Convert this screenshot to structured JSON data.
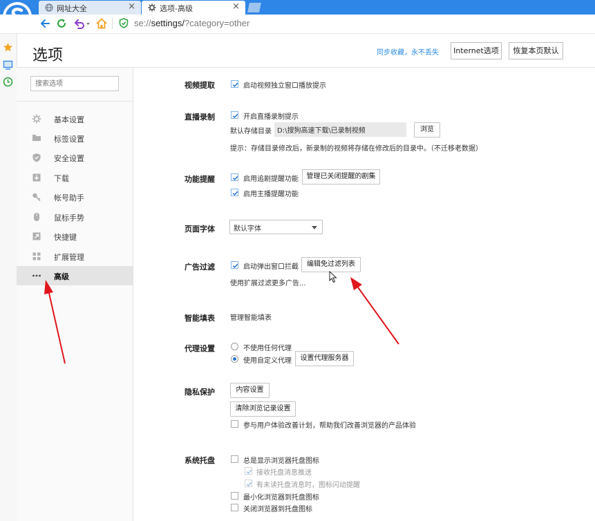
{
  "tabs": [
    {
      "title": "网址大全",
      "close": "×",
      "icon": "globe-icon",
      "active": false
    },
    {
      "title": "选项-高级",
      "close": "×",
      "icon": "gear-icon",
      "active": true
    }
  ],
  "address": {
    "scheme": "se://",
    "path": "settings/",
    "query": "?category=other"
  },
  "page": {
    "title": "选项",
    "sync_link": "同步收藏，永不丢失",
    "internet_options": "Internet选项",
    "restore_defaults": "恢复本页默认"
  },
  "search": {
    "placeholder": "搜索选项"
  },
  "sidebar": {
    "items": [
      {
        "label": "基本设置",
        "icon": "gear-icon",
        "active": false
      },
      {
        "label": "标签设置",
        "icon": "tab-icon",
        "active": false
      },
      {
        "label": "安全设置",
        "icon": "shield-icon",
        "active": false
      },
      {
        "label": "下载",
        "icon": "download-icon",
        "active": false
      },
      {
        "label": "帐号助手",
        "icon": "key-icon",
        "active": false
      },
      {
        "label": "鼠标手势",
        "icon": "mouse-icon",
        "active": false
      },
      {
        "label": "快捷键",
        "icon": "shortcut-icon",
        "active": false
      },
      {
        "label": "扩展管理",
        "icon": "extensions-icon",
        "active": false
      },
      {
        "label": "高级",
        "icon": "more-icon",
        "active": true
      }
    ]
  },
  "sections": {
    "video": {
      "label": "视频提取",
      "option": "启动视频独立窗口播放提示",
      "checked": true
    },
    "live": {
      "label": "直播录制",
      "option": "开启直播录制提示",
      "checked": true,
      "dir_label": "默认存储目录",
      "dir_value": "D:\\搜狗高速下载\\已录制视频",
      "browse": "浏览",
      "hint": "提示：存储目录修改后，新录制的视频将存储在修改后的目录中。（不迁移老数据）"
    },
    "reminder": {
      "label": "功能提醒",
      "option1": "启用追剧提醒功能",
      "option1_checked": true,
      "manage": "管理已关闭提醒的剧集",
      "option2": "启用主播提醒功能",
      "option2_checked": true
    },
    "font": {
      "label": "页面字体",
      "value": "默认字体"
    },
    "adblock": {
      "label": "广告过滤",
      "option": "启动弹出窗口拦截",
      "checked": true,
      "edit": "编辑免过滤列表",
      "more": "使用扩展过滤更多广告..."
    },
    "autofill": {
      "label": "智能填表",
      "link": "管理智能填表"
    },
    "proxy": {
      "label": "代理设置",
      "option1": "不使用任何代理",
      "option2": "使用自定义代理",
      "selected": "使用自定义代理",
      "set_server": "设置代理服务器"
    },
    "privacy": {
      "label": "隐私保护",
      "content_settings": "内容设置",
      "clear_history": "清除浏览记录设置",
      "join_program": "参与用户体验改善计划，帮助我们改善浏览器的产品体验",
      "join_checked": false
    },
    "tray": {
      "label": "系统托盘",
      "always_show": "总是显示浏览器托盘图标",
      "always_show_checked": false,
      "receive_push": "接收托盘消息推送",
      "receive_push_checked": true,
      "unread_flash": "有未读托盘消息时，图标闪动提醒",
      "unread_flash_checked": true,
      "minimize_to_tray": "最小化浏览器到托盘图标",
      "minimize_checked": false,
      "close_to_tray": "关闭浏览器到托盘图标",
      "close_checked": false
    }
  },
  "colors": {
    "accent": "#2e86e6",
    "link": "#2a8be0",
    "annotation": "#e0161b",
    "checkbox_mark": "#2a74c9"
  }
}
